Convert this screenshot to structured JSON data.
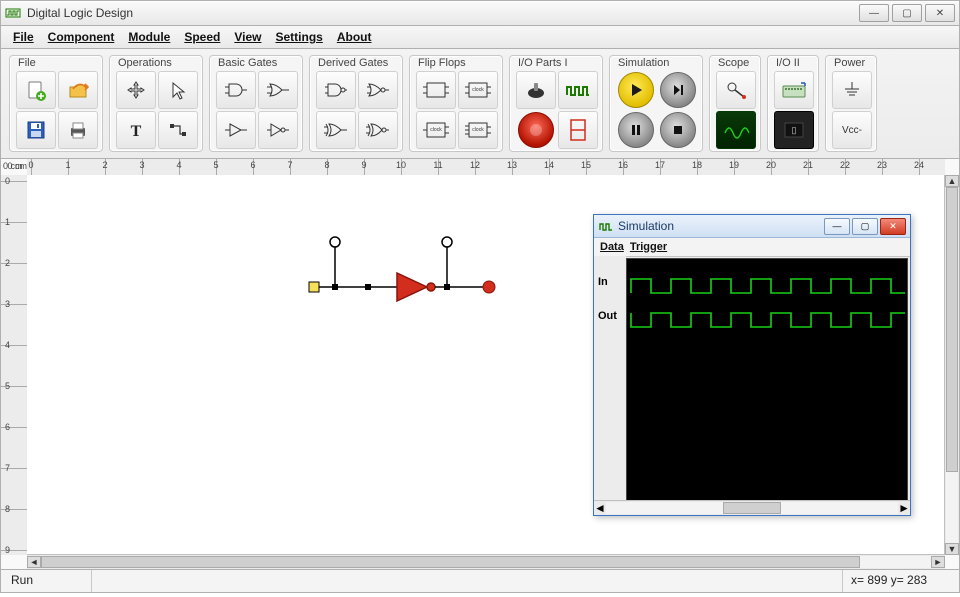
{
  "window": {
    "title": "Digital Logic Design",
    "controls": {
      "minimize": "―",
      "maximize": "▢",
      "close": "✕"
    }
  },
  "menus": [
    "File",
    "Component",
    "Module",
    "Speed",
    "View",
    "Settings",
    "About"
  ],
  "toolbar": {
    "groups": {
      "file": "File",
      "operations": "Operations",
      "basic_gates": "Basic Gates",
      "derived_gates": "Derived Gates",
      "flip_flops": "Flip Flops",
      "io_parts_1": "I/O Parts I",
      "simulation": "Simulation",
      "scope": "Scope",
      "io_2": "I/O II",
      "power": "Power"
    },
    "power_vcc": "Vcc-"
  },
  "ruler": {
    "unit": "0 cm",
    "h_ticks": [
      0,
      1,
      2,
      3,
      4,
      5,
      6,
      7,
      8,
      9,
      10,
      11,
      12,
      13,
      14,
      15,
      16,
      17,
      18,
      19,
      20,
      21,
      22,
      23,
      24
    ],
    "v_ticks": [
      0,
      1,
      2,
      3,
      4,
      5,
      6,
      7,
      8,
      9
    ],
    "v_unit": "0 cm"
  },
  "simulation_window": {
    "title": "Simulation",
    "menus": [
      "Data",
      "Trigger"
    ],
    "signals": [
      "In",
      "Out"
    ],
    "controls": {
      "minimize": "―",
      "maximize": "▢",
      "close": "✕"
    }
  },
  "status": {
    "mode": "Run",
    "coords": "x= 899  y= 283"
  },
  "colors": {
    "accent": "#1c7a00",
    "wave": "#19d019",
    "selection_red": "#d12e1e"
  }
}
